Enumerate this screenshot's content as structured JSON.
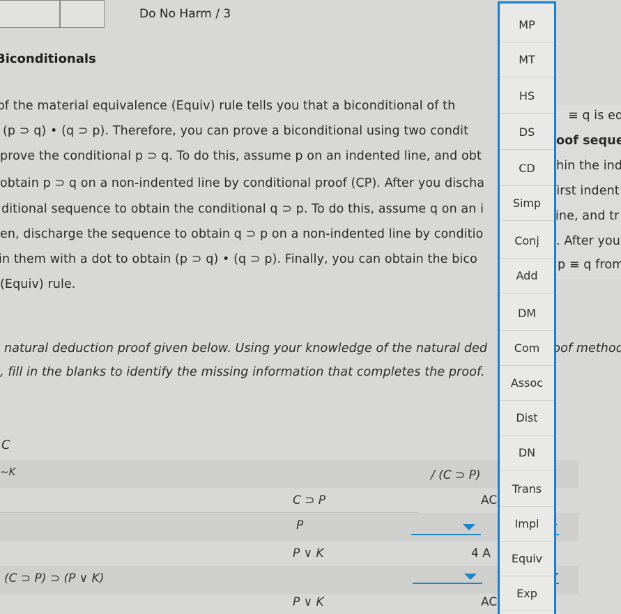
{
  "header": {
    "breadcrumb": "Do No Harm / 3",
    "section_title": "Biconditionals"
  },
  "instructions": {
    "lines": [
      "of the material equivalence (Equiv) rule tells you that a biconditional of th",
      "(p ⊃ q) • (q ⊃ p). Therefore, you can prove a biconditional using two condit",
      "prove the conditional p ⊃ q. To do this, assume p on an indented line, and obt",
      "obtain p ⊃ q on a non-indented line by conditional proof (CP). After you discha",
      "ditional sequence to obtain the conditional q ⊃ p. To do this, assume q on an i",
      "en, discharge the sequence to obtain q ⊃ p on a non-indented line by conditio",
      "in them with a dot to obtain (p ⊃ q) • (q ⊃ p). Finally, you can obtain the bico",
      "(Equiv) rule."
    ],
    "right_fragments": [
      "≡ q is equ",
      "oof seque",
      "hin the ind",
      "first indent",
      "line, and tr",
      ". After you",
      "p ≡ q from"
    ]
  },
  "task": {
    "line1": "natural deduction proof given below. Using your knowledge of the natural ded",
    "line1_right": "roof method",
    "line2": ", fill in the blanks to identify the missing information that completes the proof."
  },
  "proof": {
    "premise_c": "C",
    "premise_k": "~K",
    "conclusion": "/ (C ⊃ P)",
    "conclusion_tail": ")",
    "lines": [
      {
        "formula": "C ⊃ P",
        "justification": "AC"
      },
      {
        "formula": "P",
        "justification": ""
      },
      {
        "formula": "P ∨ K",
        "justification": "4 A"
      },
      {
        "formula": "(C ⊃ P) ⊃ (P ∨ K)",
        "justification": ""
      },
      {
        "formula": "P ∨ K",
        "justification": "AC"
      }
    ]
  },
  "rules": [
    "MP",
    "MT",
    "HS",
    "DS",
    "CD",
    "Simp",
    "Conj",
    "Add",
    "DM",
    "Com",
    "Assoc",
    "Dist",
    "DN",
    "Trans",
    "Impl",
    "Equiv",
    "Exp"
  ],
  "colors": {
    "accent": "#1b7fd0",
    "dropdown": "#1c84c6",
    "background": "#d8d9d6"
  }
}
